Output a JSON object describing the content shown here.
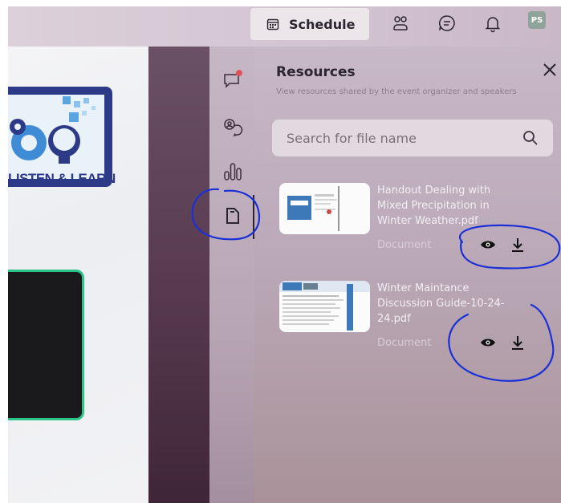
{
  "topbar": {
    "schedule_label": "Schedule",
    "avatar_initials": "PS"
  },
  "stage": {
    "logo_text": "LISTEN & LEARN"
  },
  "resources": {
    "title": "Resources",
    "subtitle": "View resources shared by the event organizer and speakers",
    "search_placeholder": "Search for file name",
    "files": [
      {
        "name": "Handout Dealing with Mixed Precipitation in Winter Weather.pdf",
        "type": "Document"
      },
      {
        "name": "Winter Maintance Discussion Guide-10-24-24.pdf",
        "type": "Document"
      }
    ]
  },
  "colors": {
    "accent_dark": "#2b2530",
    "annotation_blue": "#1b2fd8",
    "chat_badge": "#e0525a",
    "video_border": "#2cc48b",
    "logo_blue": "#2c3a87"
  },
  "icons": {
    "schedule": "calendar-icon",
    "people": "people-icon",
    "chat": "chat-bubble-icon",
    "notifications": "bell-icon",
    "rail": [
      "chat-notification-icon",
      "people-chat-icon",
      "poll-chart-icon",
      "document-icon"
    ],
    "close": "close-icon",
    "search": "search-icon",
    "view": "eye-icon",
    "download": "download-icon"
  }
}
